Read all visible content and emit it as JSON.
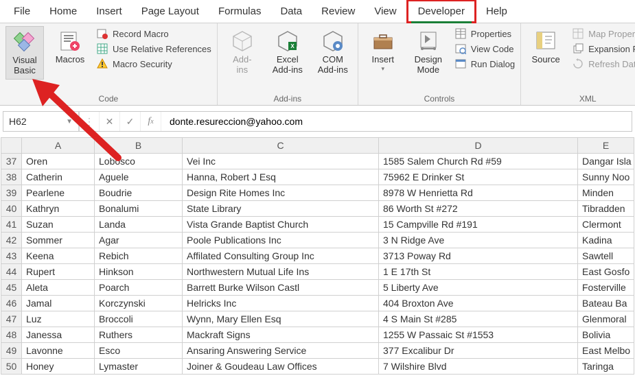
{
  "menu": [
    "File",
    "Home",
    "Insert",
    "Page Layout",
    "Formulas",
    "Data",
    "Review",
    "View",
    "Developer",
    "Help"
  ],
  "menu_active": "Developer",
  "ribbon": {
    "code": {
      "label": "Code",
      "visual_basic": "Visual\nBasic",
      "macros": "Macros",
      "record_macro": "Record Macro",
      "use_relative": "Use Relative References",
      "macro_security": "Macro Security"
    },
    "addins": {
      "label": "Add-ins",
      "add_ins": "Add-\nins",
      "excel_addins": "Excel\nAdd-ins",
      "com_addins": "COM\nAdd-ins"
    },
    "controls": {
      "label": "Controls",
      "insert": "Insert",
      "design_mode": "Design\nMode",
      "properties": "Properties",
      "view_code": "View Code",
      "run_dialog": "Run Dialog"
    },
    "xml": {
      "label": "XML",
      "source": "Source",
      "map_properties": "Map Properties",
      "expansion_packs": "Expansion Pac",
      "refresh_data": "Refresh Data"
    }
  },
  "formula_bar": {
    "cell_ref": "H62",
    "formula": "donte.resureccion@yahoo.com"
  },
  "columns": [
    "A",
    "B",
    "C",
    "D",
    "E"
  ],
  "rows": [
    {
      "n": 37,
      "a": "Oren",
      "b": "Lobosco",
      "c": "Vei Inc",
      "d": "1585 Salem Church Rd #59",
      "e": "Dangar Isla"
    },
    {
      "n": 38,
      "a": "Catherin",
      "b": "Aguele",
      "c": "Hanna, Robert J Esq",
      "d": "75962 E Drinker St",
      "e": "Sunny Noo"
    },
    {
      "n": 39,
      "a": "Pearlene",
      "b": "Boudrie",
      "c": "Design Rite Homes Inc",
      "d": "8978 W Henrietta Rd",
      "e": "Minden"
    },
    {
      "n": 40,
      "a": "Kathryn",
      "b": "Bonalumi",
      "c": "State Library",
      "d": "86 Worth St #272",
      "e": "Tibradden"
    },
    {
      "n": 41,
      "a": "Suzan",
      "b": "Landa",
      "c": "Vista Grande Baptist Church",
      "d": "15 Campville Rd #191",
      "e": "Clermont"
    },
    {
      "n": 42,
      "a": "Sommer",
      "b": "Agar",
      "c": "Poole Publications Inc",
      "d": "3 N Ridge Ave",
      "e": "Kadina"
    },
    {
      "n": 43,
      "a": "Keena",
      "b": "Rebich",
      "c": "Affilated Consulting Group Inc",
      "d": "3713 Poway Rd",
      "e": "Sawtell"
    },
    {
      "n": 44,
      "a": "Rupert",
      "b": "Hinkson",
      "c": "Northwestern Mutual Life Ins",
      "d": "1 E 17th St",
      "e": "East Gosfo"
    },
    {
      "n": 45,
      "a": "Aleta",
      "b": "Poarch",
      "c": "Barrett Burke Wilson Castl",
      "d": "5 Liberty Ave",
      "e": "Fosterville"
    },
    {
      "n": 46,
      "a": "Jamal",
      "b": "Korczynski",
      "c": "Helricks Inc",
      "d": "404 Broxton Ave",
      "e": "Bateau Ba"
    },
    {
      "n": 47,
      "a": "Luz",
      "b": "Broccoli",
      "c": "Wynn, Mary Ellen Esq",
      "d": "4 S Main St #285",
      "e": "Glenmoral"
    },
    {
      "n": 48,
      "a": "Janessa",
      "b": "Ruthers",
      "c": "Mackraft Signs",
      "d": "1255 W Passaic St #1553",
      "e": "Bolivia"
    },
    {
      "n": 49,
      "a": "Lavonne",
      "b": "Esco",
      "c": "Ansaring Answering Service",
      "d": "377 Excalibur Dr",
      "e": "East Melbo"
    },
    {
      "n": 50,
      "a": "Honey",
      "b": "Lymaster",
      "c": "Joiner & Goudeau Law Offices",
      "d": "7 Wilshire Blvd",
      "e": "Taringa"
    }
  ]
}
